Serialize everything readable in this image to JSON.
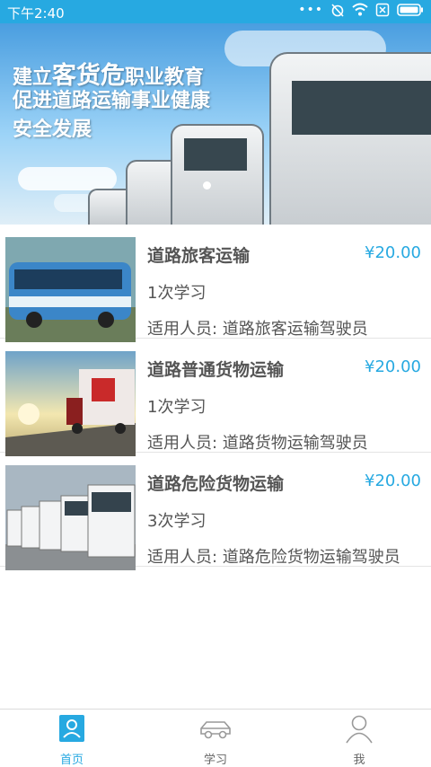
{
  "status_bar": {
    "time": "下午2:40"
  },
  "banner": {
    "line1_a": "建立",
    "line1_b": "客货危",
    "line1_c": "职业教育",
    "line2": "促进道路运输事业健康",
    "line3": "安全发展"
  },
  "courses": [
    {
      "title": "道路旅客运输",
      "price": "¥20.00",
      "count": "1次学习",
      "people": "适用人员: 道路旅客运输驾驶员"
    },
    {
      "title": "道路普通货物运输",
      "price": "¥20.00",
      "count": "1次学习",
      "people": "适用人员: 道路货物运输驾驶员"
    },
    {
      "title": "道路危险货物运输",
      "price": "¥20.00",
      "count": "3次学习",
      "people": "适用人员: 道路危险货物运输驾驶员"
    }
  ],
  "tabs": [
    {
      "label": "首页",
      "icon": "home-icon"
    },
    {
      "label": "学习",
      "icon": "car-icon"
    },
    {
      "label": "我",
      "icon": "person-icon"
    }
  ],
  "colors": {
    "accent": "#27a9e1",
    "text": "#555555"
  }
}
